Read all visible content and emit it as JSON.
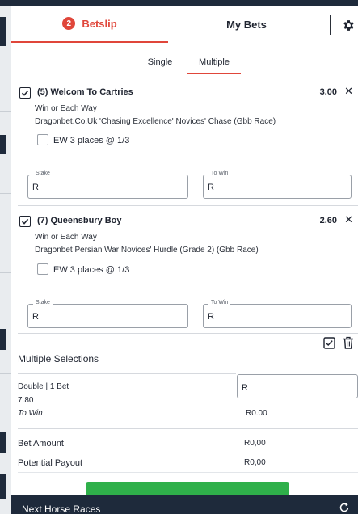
{
  "tabs": {
    "betslip_label": "Betslip",
    "betslip_count": "2",
    "mybets_label": "My Bets"
  },
  "subtabs": {
    "single_label": "Single",
    "multiple_label": "Multiple",
    "active": "Multiple"
  },
  "selections": [
    {
      "title": "(5) Welcom To Cartries",
      "odds": "3.00",
      "bet_type": "Win or Each Way",
      "race": "Dragonbet.Co.Uk 'Chasing Excellence' Novices' Chase (Gbb Race)",
      "ew_label": "EW 3 places @ 1/3",
      "checked": true,
      "ew_checked": false,
      "stake_label": "Stake",
      "stake_value": "R",
      "towin_label": "To Win",
      "towin_value": "R"
    },
    {
      "title": "(7) Queensbury Boy",
      "odds": "2.60",
      "bet_type": "Win or Each Way",
      "race": "Dragonbet Persian War Novices' Hurdle (Grade 2) (Gbb Race)",
      "ew_label": "EW 3 places @ 1/3",
      "checked": true,
      "ew_checked": false,
      "stake_label": "Stake",
      "stake_value": "R",
      "towin_label": "To Win",
      "towin_value": "R"
    }
  ],
  "multiples": {
    "title": "Multiple Selections",
    "double_label": "Double | 1 Bet",
    "double_odds": "7.80",
    "towin_label": "To Win",
    "towin_value": "R0.00",
    "stake_value": "R"
  },
  "summary": {
    "bet_amount_label": "Bet Amount",
    "bet_amount_value": "R0,00",
    "payout_label": "Potential Payout",
    "payout_value": "R0,00"
  },
  "footer": {
    "label": "Next Horse Races"
  },
  "colors": {
    "accent": "#e0463a",
    "dark": "#1e2a3b",
    "place_bet": "#2fb04a"
  }
}
